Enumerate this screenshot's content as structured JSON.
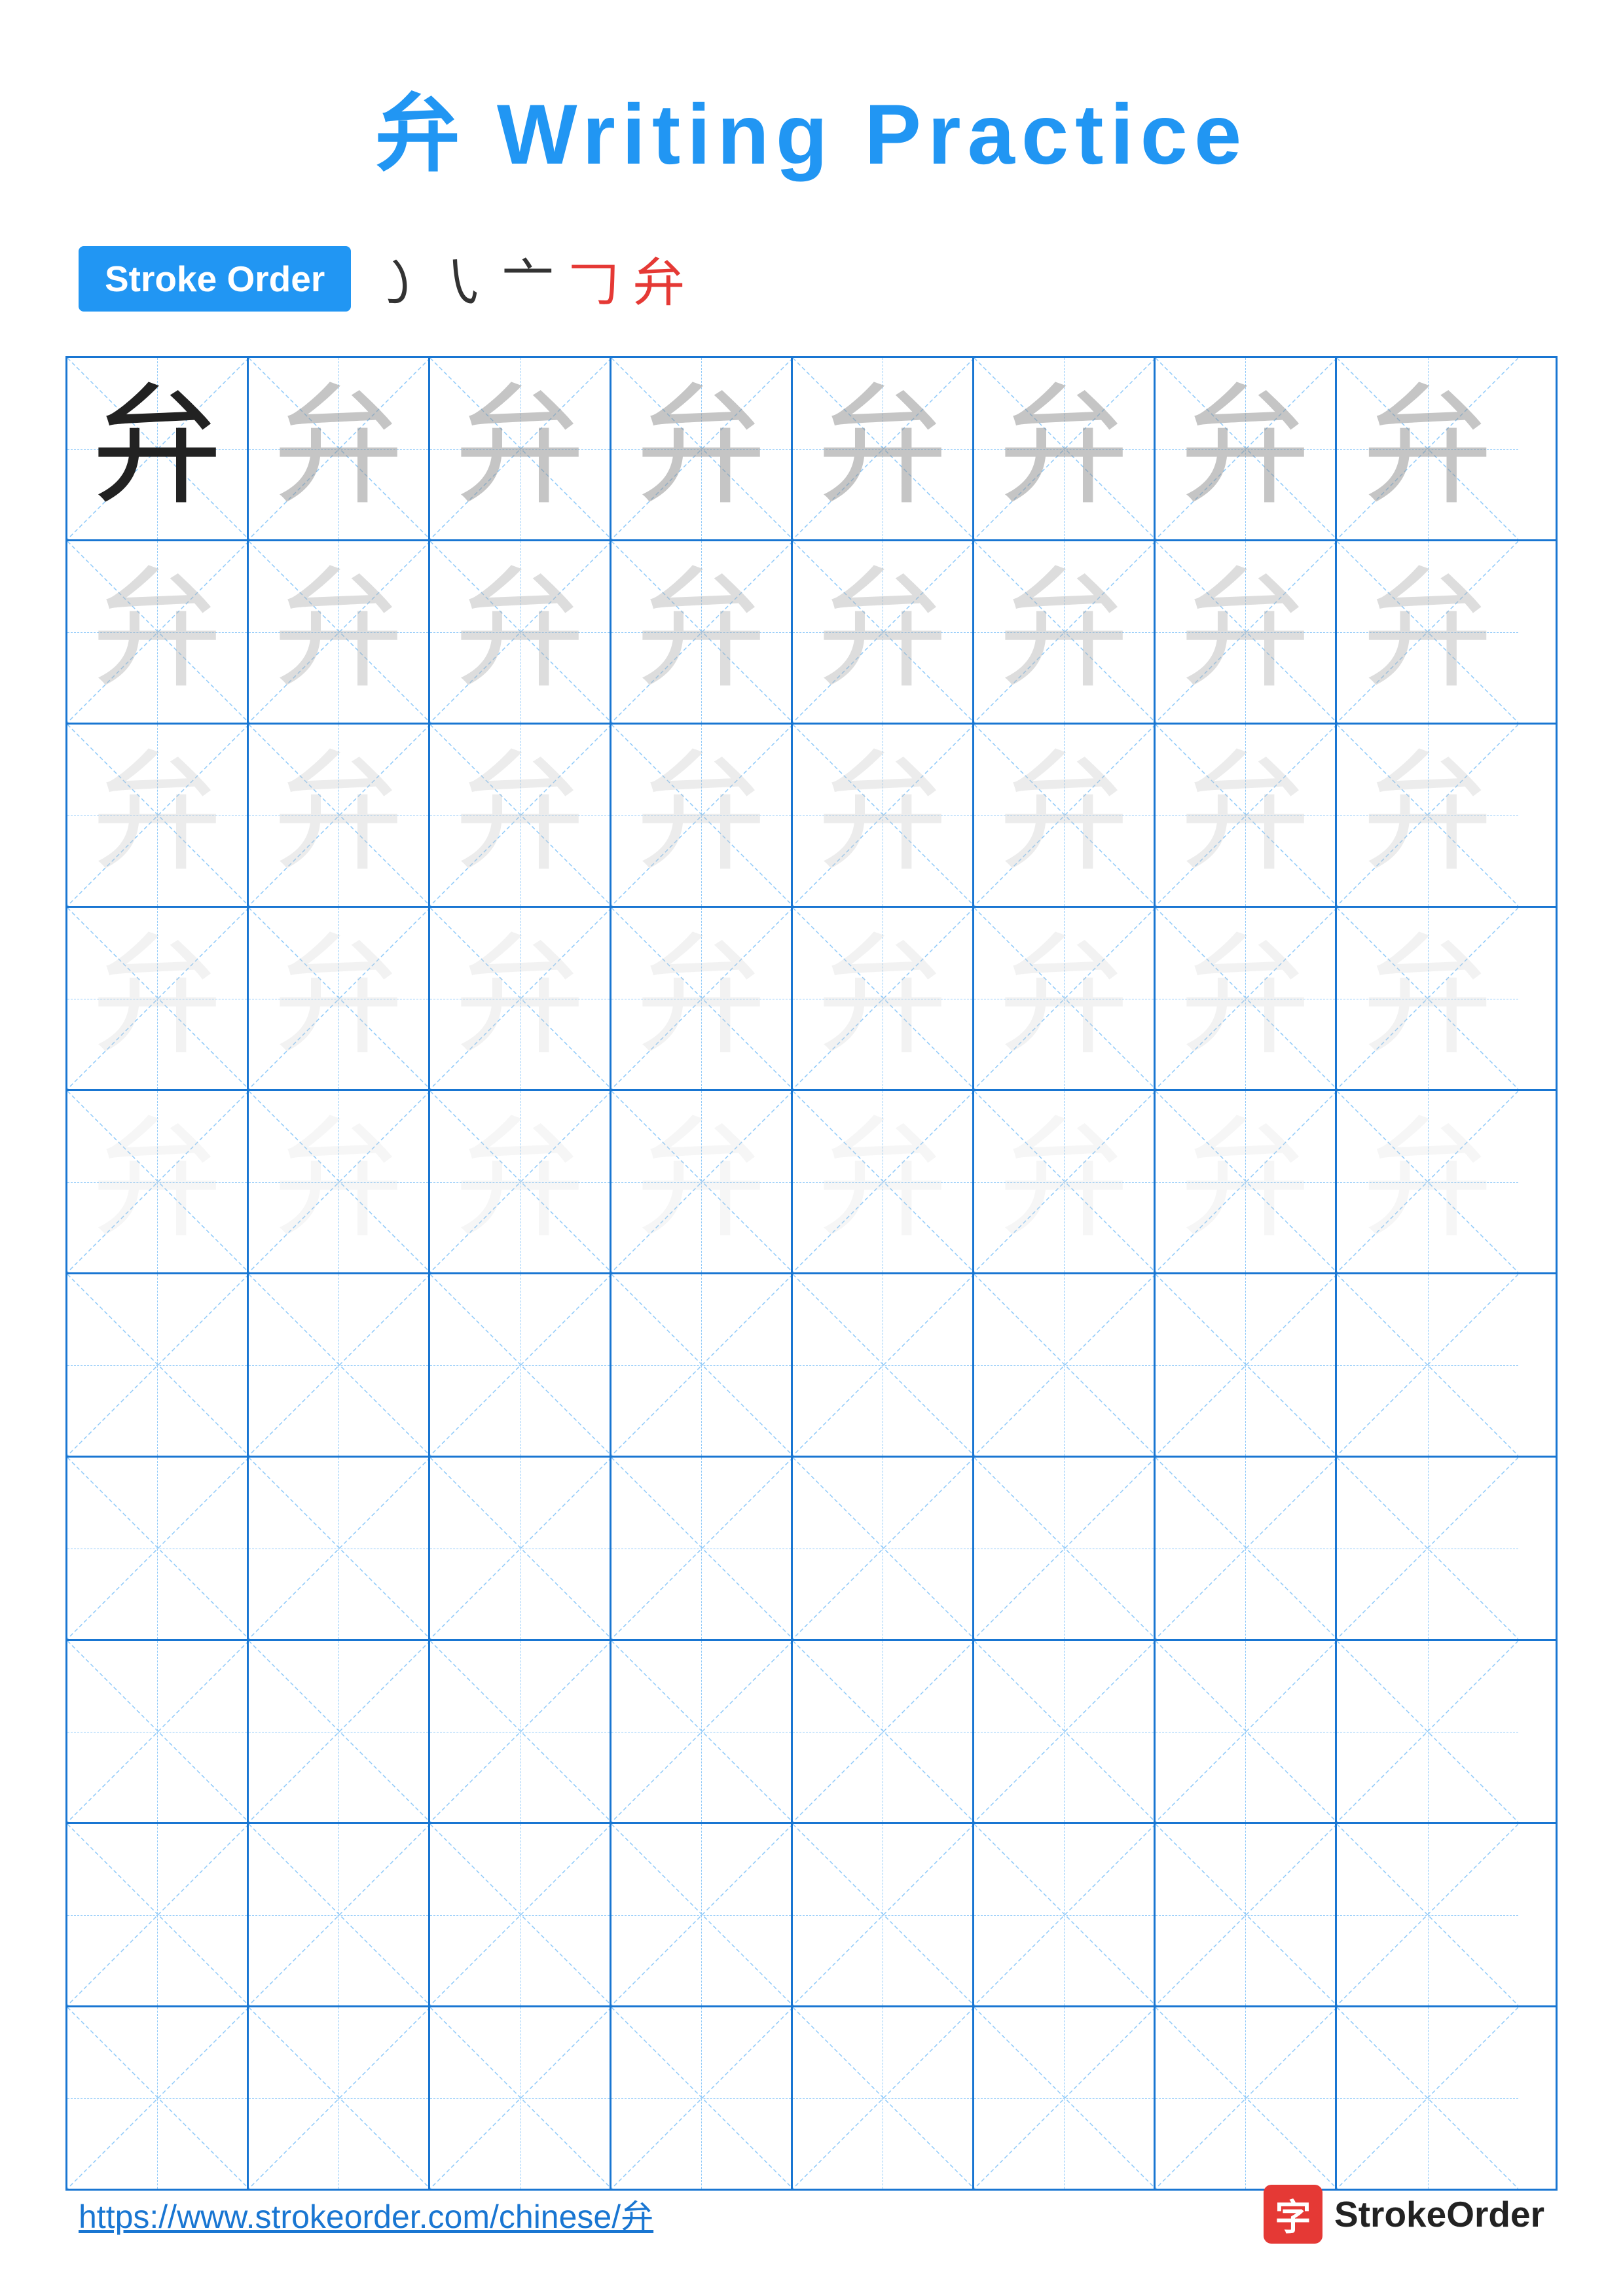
{
  "title": {
    "character": "弁",
    "rest": " Writing Practice"
  },
  "stroke_order": {
    "badge_label": "Stroke Order",
    "strokes": [
      "㇁",
      "㇂",
      "二",
      "𠃌",
      "弁"
    ]
  },
  "grid": {
    "rows": 10,
    "cols": 8,
    "character": "弁",
    "guide_rows": 5,
    "empty_rows": 5
  },
  "footer": {
    "url": "https://www.strokeorder.com/chinese/弁",
    "logo_char": "字",
    "logo_text": "StrokeOrder"
  },
  "colors": {
    "blue": "#2196F3",
    "dark_blue": "#1976D2",
    "red": "#e53935",
    "light_blue_dashed": "#90CAF9"
  }
}
